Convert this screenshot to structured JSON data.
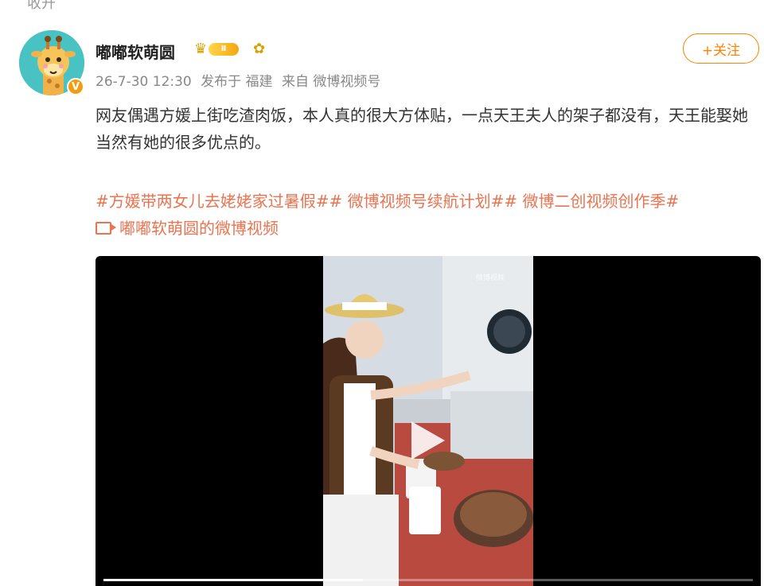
{
  "top_fragment": "收开",
  "user": {
    "name": "嘟嘟软萌圆",
    "vip_level": "Ⅱ",
    "verified_mark": "V"
  },
  "meta": {
    "timestamp": "26-7-30 12:30",
    "published_at": "发布于 福建",
    "source": "来自 微博视频号"
  },
  "follow_label": "+关注",
  "post": {
    "text": "网友偶遇方媛上街吃渣肉饭，本人真的很大方体贴，一点天王夫人的架子都没有，天王能娶她当然有她的很多优点的。",
    "hashtag_line1": "#方媛带两女儿去姥姥家过暑假## 微博视频号续航计划## 微博二创视频创作季#",
    "video_link_label": "嘟嘟软萌圆的微博视频"
  },
  "video": {
    "progress": 0.4,
    "watermark": "微博视频"
  },
  "colors": {
    "accent": "#ff8200",
    "hashtag": "#eb7350",
    "meta": "#888888",
    "avatar_bg": "#49c2c3",
    "verified": "#f39c12"
  },
  "icons": [
    "crown-icon",
    "flower-icon",
    "video-link-icon",
    "play-icon",
    "verified-icon"
  ]
}
